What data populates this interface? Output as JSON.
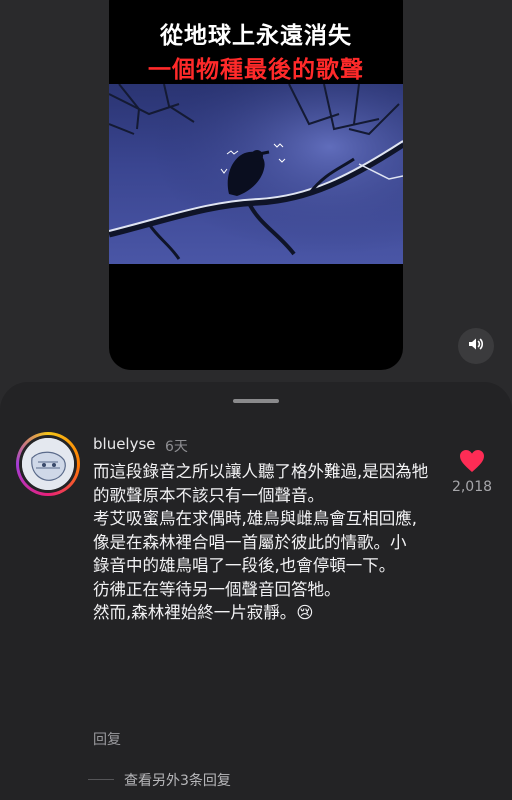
{
  "video": {
    "title_line1": "從地球上永遠消失",
    "title_line2": "一個物種最後的歌聲",
    "title_line2_color": "#ff2a2a",
    "sound_icon": "speaker-icon"
  },
  "comment": {
    "username": "bluelyse",
    "time": "6天",
    "lines": [
      "而這段錄音之所以讓人聽了格外難過,是因為牠的歌聲原本不該只有一個聲音。",
      "考艾吸蜜鳥在求偶時,雄鳥與雌鳥會互相回應,像是在森林裡合唱一首屬於彼此的情歌。小",
      "錄音中的雄鳥唱了一段後,也會停頓一下。",
      "彷彿正在等待另一個聲音回答牠。",
      "然而,森林裡始終一片寂靜。😢"
    ],
    "reply_label": "回复",
    "like_count": "2,018",
    "like_color": "#fe2c55",
    "more_replies": "查看另外3条回复"
  }
}
